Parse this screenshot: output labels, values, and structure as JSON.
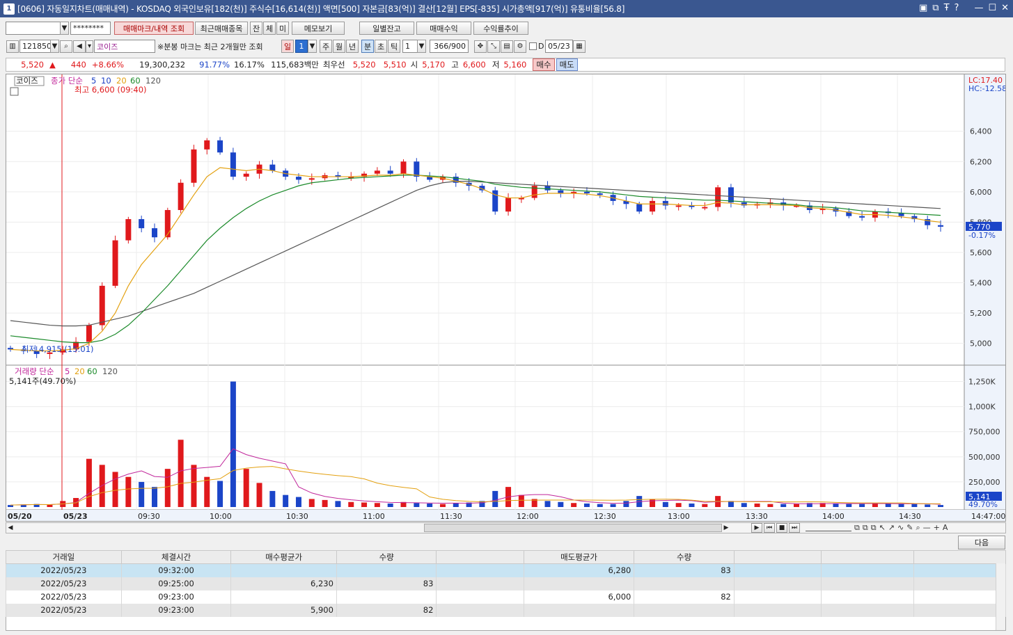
{
  "window": {
    "badge": "1",
    "title": "[0606] 자동일지차트(매매내역) - KOSDAQ 외국인보유[182(천)] 주식수[16,614(천)] 액면[500] 자본금[83(억)] 결산[12월] EPS[-835] 시가총액[917(억)] 유통비율[56.8]",
    "icons": [
      "layout-icon",
      "window-icon",
      "pin-icon",
      "help-icon",
      "minimize-icon",
      "maximize-icon",
      "close-icon"
    ],
    "icon_glyphs": [
      "▣",
      "⧉",
      "Ŧ",
      "?",
      "—",
      "☐",
      "✕"
    ]
  },
  "toolbar1": {
    "account_value": "",
    "password_value": "********",
    "buttons": [
      "매매마크/내역 조회",
      "최근매매종목",
      "잔",
      "체",
      "미",
      "메모보기",
      "일별잔고",
      "매매수익",
      "수익률추이"
    ]
  },
  "toolbar2": {
    "code": "121850",
    "stock_name": "코이즈",
    "notice": "※분봉 마크는 최근 2개월만 조회",
    "period_buttons": [
      "일",
      "1",
      "주",
      "월",
      "년",
      "분",
      "초",
      "틱"
    ],
    "interval": "1",
    "count": "366/900",
    "d_label": "D",
    "date": "05/23"
  },
  "quote": {
    "price": "5,520",
    "arrow": "▲",
    "change": "440",
    "change_pct": "+8.66%",
    "volume": "19,300,232",
    "ratio1": "91.77%",
    "ratio2": "16.17%",
    "amount": "115,683백만",
    "best_label": "최우선",
    "best_ask": "5,520",
    "best_bid": "5,510",
    "open_label": "시",
    "open": "5,170",
    "high_label": "고",
    "high": "6,600",
    "low_label": "저",
    "low": "5,160",
    "buy_label": "매수",
    "sell_label": "매도"
  },
  "chart_data": {
    "type": "candlestick",
    "price_panel": {
      "legend_name": "코이즈",
      "legend_items": [
        "종가 단순",
        "5",
        "10",
        "20",
        "60",
        "120"
      ],
      "legend_colors": [
        "#c0259a",
        "#1b3fc4",
        "#1b3fc4",
        "#e3a00f",
        "#1b8a2a",
        "#555555"
      ],
      "high_annotation": "최고 6,600 (09:40)",
      "low_annotation": "최저 4,915 (15:01)",
      "lc_label": "LC:17.40",
      "hc_label": "HC:-12.58",
      "y_ticks": [
        "6,400",
        "6,200",
        "6,000",
        "5,800",
        "5,600",
        "5,400",
        "5,200",
        "5,000"
      ],
      "ylim": [
        4870,
        6720
      ],
      "current_price": "5,770",
      "current_change": "-0.17%",
      "close_series": [
        4960,
        4950,
        4930,
        4940,
        4960,
        5010,
        5120,
        5380,
        5680,
        5820,
        5760,
        5700,
        5880,
        6060,
        6280,
        6340,
        6260,
        6100,
        6120,
        6180,
        6140,
        6100,
        6080,
        6090,
        6110,
        6100,
        6100,
        6120,
        6140,
        6120,
        6200,
        6100,
        6080,
        6100,
        6060,
        6040,
        6010,
        5870,
        5960,
        5960,
        6040,
        6010,
        5990,
        6000,
        5990,
        5980,
        5940,
        5920,
        5870,
        5940,
        5910,
        5910,
        5900,
        5900,
        6030,
        5930,
        5910,
        5920,
        5930,
        5910,
        5910,
        5880,
        5890,
        5870,
        5840,
        5830,
        5870,
        5860,
        5840,
        5820,
        5780,
        5770
      ],
      "ma_20": [
        4960,
        4955,
        4950,
        4950,
        4955,
        4965,
        5000,
        5080,
        5200,
        5380,
        5520,
        5620,
        5720,
        5850,
        5980,
        6100,
        6160,
        6150,
        6140,
        6150,
        6140,
        6120,
        6110,
        6100,
        6100,
        6100,
        6100,
        6105,
        6110,
        6110,
        6120,
        6110,
        6100,
        6090,
        6070,
        6050,
        6020,
        5980,
        5960,
        5960,
        5980,
        5990,
        5990,
        5990,
        5985,
        5975,
        5960,
        5940,
        5920,
        5920,
        5920,
        5915,
        5910,
        5910,
        5930,
        5925,
        5915,
        5915,
        5915,
        5912,
        5910,
        5895,
        5890,
        5880,
        5865,
        5850,
        5850,
        5845,
        5835,
        5825,
        5810,
        5800
      ],
      "ma_60": [
        5050,
        5040,
        5030,
        5020,
        5010,
        5005,
        5005,
        5020,
        5060,
        5120,
        5200,
        5290,
        5380,
        5480,
        5580,
        5680,
        5760,
        5830,
        5890,
        5940,
        5980,
        6010,
        6040,
        6060,
        6070,
        6080,
        6090,
        6095,
        6100,
        6105,
        6110,
        6110,
        6105,
        6100,
        6090,
        6080,
        6070,
        6050,
        6040,
        6030,
        6025,
        6020,
        6015,
        6010,
        6005,
        6000,
        5990,
        5980,
        5970,
        5965,
        5960,
        5955,
        5950,
        5945,
        5945,
        5940,
        5935,
        5930,
        5925,
        5920,
        5915,
        5905,
        5900,
        5895,
        5885,
        5875,
        5870,
        5865,
        5860,
        5855,
        5850,
        5845
      ],
      "ma_120": [
        5150,
        5140,
        5130,
        5120,
        5115,
        5115,
        5120,
        5140,
        5160,
        5180,
        5210,
        5240,
        5270,
        5300,
        5330,
        5370,
        5410,
        5450,
        5490,
        5530,
        5570,
        5610,
        5650,
        5690,
        5730,
        5770,
        5810,
        5850,
        5890,
        5930,
        5970,
        6010,
        6040,
        6060,
        6070,
        6070,
        6065,
        6060,
        6055,
        6050,
        6045,
        6040,
        6035,
        6030,
        6025,
        6020,
        6015,
        6010,
        6005,
        6000,
        5995,
        5990,
        5985,
        5980,
        5975,
        5970,
        5965,
        5960,
        5955,
        5950,
        5945,
        5940,
        5935,
        5930,
        5925,
        5920,
        5915,
        5910,
        5905,
        5900,
        5895,
        5890
      ]
    },
    "volume_panel": {
      "legend_items": [
        "거래량 단순",
        "5",
        "20",
        "60",
        "120"
      ],
      "legend_colors": [
        "#c0259a",
        "#c0259a",
        "#e3a00f",
        "#1b8a2a",
        "#555555"
      ],
      "summary": "5,141주(49.70%)",
      "y_ticks": [
        "1,250K",
        "1,000K",
        "750,000",
        "500,000",
        "250,000"
      ],
      "ylim": [
        0,
        1330000
      ],
      "current_volume": "5,141",
      "current_pct": "49.70%",
      "volumes": [
        20000,
        25000,
        30000,
        22000,
        60000,
        90000,
        480000,
        420000,
        350000,
        300000,
        250000,
        200000,
        380000,
        670000,
        420000,
        300000,
        260000,
        1250000,
        380000,
        240000,
        160000,
        120000,
        100000,
        80000,
        70000,
        60000,
        50000,
        45000,
        40000,
        35000,
        50000,
        40000,
        35000,
        30000,
        40000,
        45000,
        60000,
        160000,
        200000,
        120000,
        80000,
        60000,
        50000,
        40000,
        35000,
        30000,
        30000,
        60000,
        110000,
        80000,
        50000,
        40000,
        35000,
        30000,
        110000,
        60000,
        40000,
        35000,
        30000,
        30000,
        30000,
        40000,
        40000,
        35000,
        30000,
        30000,
        40000,
        35000,
        30000,
        30000,
        25000,
        20000
      ]
    },
    "x_labels": [
      "05/20",
      "05/23",
      "09:30",
      "10:00",
      "10:30",
      "11:00",
      "11:30",
      "12:00",
      "12:30",
      "13:00",
      "13:30",
      "14:00",
      "14:30",
      "14:47:00"
    ],
    "colors": {
      "up": "#e0191c",
      "down": "#1b45c8",
      "ma5": "#c0259a",
      "ma10": "#1b3fc4",
      "ma20": "#e3a00f",
      "ma60": "#1b8a2a",
      "ma120": "#555555"
    }
  },
  "scroll_controls": [
    "▶",
    "⏮",
    "■",
    "⏭"
  ],
  "next_button": "다음",
  "grid": {
    "headers": [
      "거래일",
      "체결시간",
      "매수평균가",
      "수량",
      "",
      "매도평균가",
      "수량",
      "",
      "",
      ""
    ],
    "rows": [
      [
        "2022/05/23",
        "09:32:00",
        "",
        "",
        "",
        "6,280",
        "83",
        "",
        "",
        ""
      ],
      [
        "2022/05/23",
        "09:25:00",
        "6,230",
        "83",
        "",
        "",
        "",
        "",
        "",
        ""
      ],
      [
        "2022/05/23",
        "09:23:00",
        "",
        "",
        "",
        "6,000",
        "82",
        "",
        "",
        ""
      ],
      [
        "2022/05/23",
        "09:23:00",
        "5,900",
        "82",
        "",
        "",
        "",
        "",
        "",
        ""
      ]
    ]
  }
}
